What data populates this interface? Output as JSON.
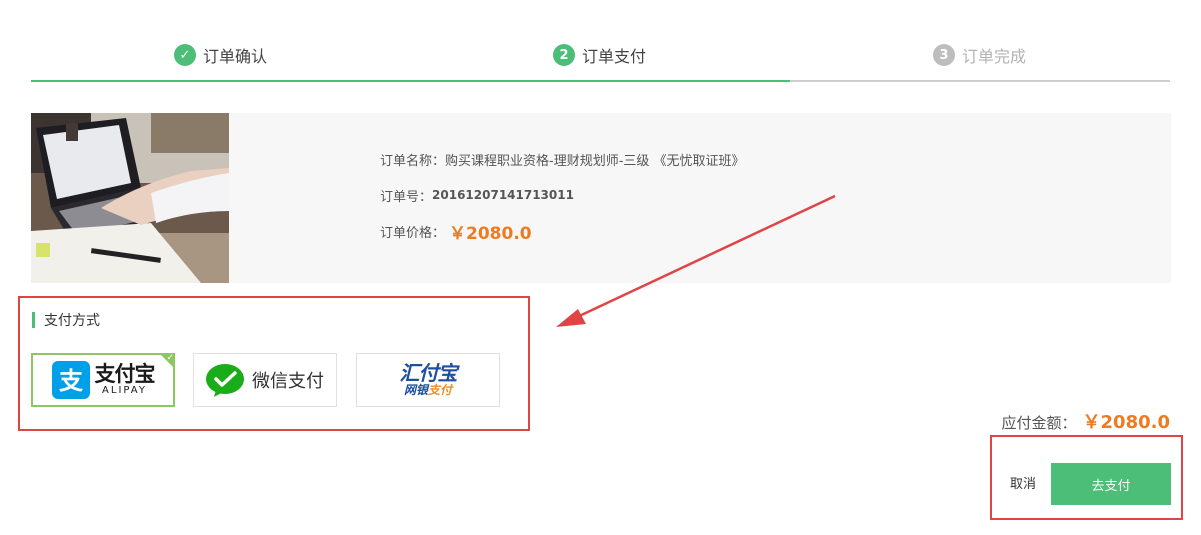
{
  "steps": [
    {
      "num": "✓",
      "label": "订单确认",
      "state": "done"
    },
    {
      "num": "2",
      "label": "订单支付",
      "state": "active"
    },
    {
      "num": "3",
      "label": "订单完成",
      "state": "pending"
    }
  ],
  "order": {
    "name_label": "订单名称：",
    "name_value": "购买课程职业资格-理财规划师-三级 《无忧取证班》",
    "number_label": "订单号：",
    "number_value": "20161207141713011",
    "price_label": "订单价格：",
    "price_value": "￥2080.0"
  },
  "payment": {
    "title": "支付方式",
    "options": [
      {
        "name": "alipay",
        "cn": "支付宝",
        "en": "ALIPAY",
        "selected": true
      },
      {
        "name": "wechat",
        "cn": "微信支付",
        "selected": false
      },
      {
        "name": "huifu",
        "cn1": "汇付宝",
        "cn2a": "网银",
        "cn2b": "支付",
        "selected": false
      }
    ]
  },
  "amount": {
    "label": "应付金额：",
    "value": "￥2080.0"
  },
  "actions": {
    "cancel": "取消",
    "pay": "去支付"
  },
  "colors": {
    "green": "#4cbe78",
    "orange": "#ec7b21",
    "red": "#e04444"
  }
}
